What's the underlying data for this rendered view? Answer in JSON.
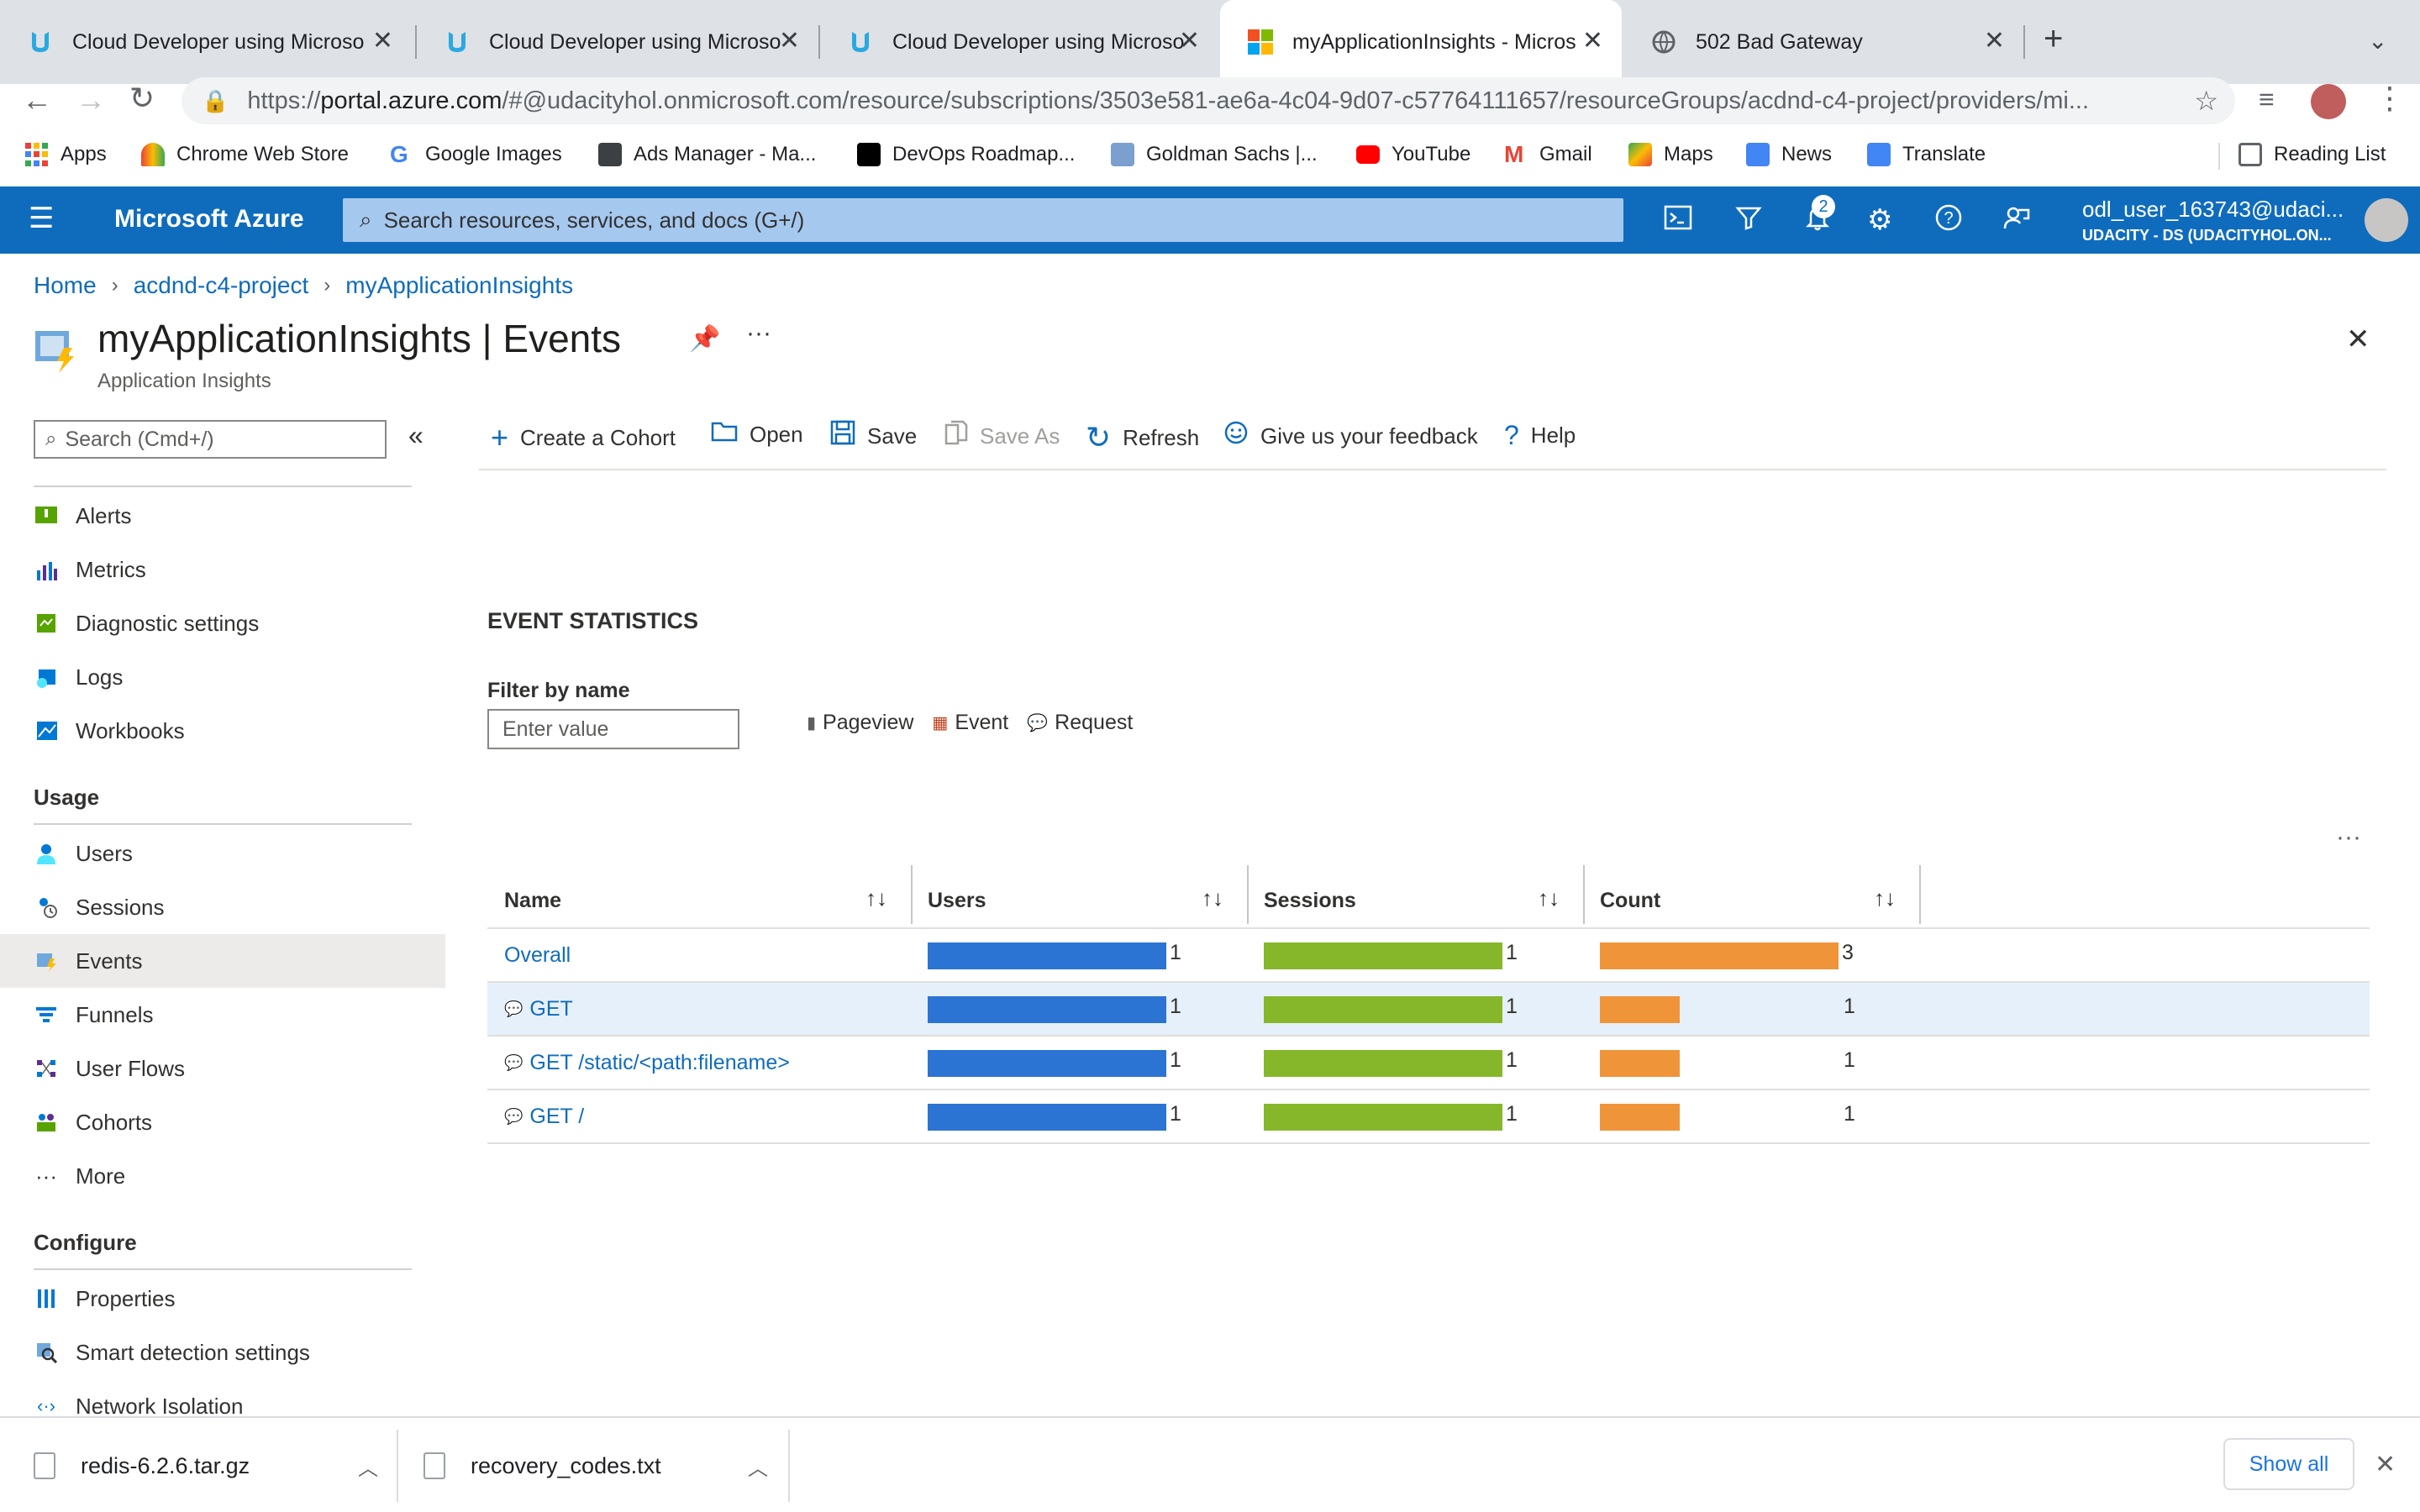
{
  "browser": {
    "tabs": [
      {
        "title": "Cloud Developer using Microso",
        "active": false
      },
      {
        "title": "Cloud Developer using Microso",
        "active": false
      },
      {
        "title": "Cloud Developer using Microso",
        "active": false
      },
      {
        "title": "myApplicationInsights - Micros",
        "active": true
      },
      {
        "title": "502 Bad Gateway",
        "active": false
      }
    ],
    "url_prefix": "https://",
    "url_host": "portal.azure.com",
    "url_path": "/#@udacityhol.onmicrosoft.com/resource/subscriptions/3503e581-ae6a-4c04-9d07-c57764111657/resourceGroups/acdnd-c4-project/providers/mi...",
    "bookmarks": [
      {
        "label": "Apps",
        "color": "#4285f4"
      },
      {
        "label": "Chrome Web Store",
        "color": "#ea4335"
      },
      {
        "label": "Google Images",
        "color": "#34a853"
      },
      {
        "label": "Ads Manager - Ma...",
        "color": "#3c4043"
      },
      {
        "label": "DevOps Roadmap...",
        "color": "#000000"
      },
      {
        "label": "Goldman Sachs |...",
        "color": "#7b9fcf"
      },
      {
        "label": "YouTube",
        "color": "#ff0000"
      },
      {
        "label": "Gmail",
        "color": "#ea4335"
      },
      {
        "label": "Maps",
        "color": "#34a853"
      },
      {
        "label": "News",
        "color": "#4285f4"
      },
      {
        "label": "Translate",
        "color": "#4285f4"
      }
    ],
    "reading_list": "Reading List"
  },
  "azure": {
    "brand": "Microsoft Azure",
    "search_placeholder": "Search resources, services, and docs (G+/)",
    "notification_count": "2",
    "user_name": "odl_user_163743@udaci...",
    "user_tenant": "UDACITY - DS (UDACITYHOL.ON..."
  },
  "breadcrumb": [
    "Home",
    "acdnd-c4-project",
    "myApplicationInsights"
  ],
  "page": {
    "title": "myApplicationInsights | Events",
    "subtitle": "Application Insights"
  },
  "leftnav": {
    "search_placeholder": "Search (Cmd+/)",
    "items_top": [
      {
        "label": "Alerts",
        "icon": "alert-icon"
      },
      {
        "label": "Metrics",
        "icon": "metrics-icon"
      },
      {
        "label": "Diagnostic settings",
        "icon": "diagnostic-icon"
      },
      {
        "label": "Logs",
        "icon": "logs-icon"
      },
      {
        "label": "Workbooks",
        "icon": "workbooks-icon"
      }
    ],
    "usage_header": "Usage",
    "items_usage": [
      {
        "label": "Users",
        "icon": "users-icon"
      },
      {
        "label": "Sessions",
        "icon": "sessions-icon"
      },
      {
        "label": "Events",
        "icon": "events-icon",
        "selected": true
      },
      {
        "label": "Funnels",
        "icon": "funnels-icon"
      },
      {
        "label": "User Flows",
        "icon": "userflows-icon"
      },
      {
        "label": "Cohorts",
        "icon": "cohorts-icon"
      },
      {
        "label": "More",
        "icon": "more-icon"
      }
    ],
    "configure_header": "Configure",
    "items_configure": [
      {
        "label": "Properties",
        "icon": "properties-icon"
      },
      {
        "label": "Smart detection settings",
        "icon": "smart-detection-icon"
      },
      {
        "label": "Network Isolation",
        "icon": "network-icon"
      }
    ]
  },
  "commandbar": {
    "create_cohort": "Create a Cohort",
    "open": "Open",
    "save": "Save",
    "save_as": "Save As",
    "refresh": "Refresh",
    "feedback": "Give us your feedback",
    "help": "Help"
  },
  "stats": {
    "heading": "EVENT STATISTICS",
    "filter_label": "Filter by name",
    "filter_placeholder": "Enter value",
    "legend": [
      "Pageview",
      "Event",
      "Request"
    ]
  },
  "table": {
    "columns": [
      "Name",
      "Users",
      "Sessions",
      "Count"
    ],
    "rows": [
      {
        "name": "Overall",
        "users": "1",
        "sessions": "1",
        "count": "3",
        "count_fraction": 1.0,
        "highlighted": false,
        "icon": false
      },
      {
        "name": "GET",
        "users": "1",
        "sessions": "1",
        "count": "1",
        "count_fraction": 0.333,
        "highlighted": true,
        "icon": true
      },
      {
        "name": "GET /static/<path:filename>",
        "users": "1",
        "sessions": "1",
        "count": "1",
        "count_fraction": 0.333,
        "highlighted": false,
        "icon": true
      },
      {
        "name": "GET /",
        "users": "1",
        "sessions": "1",
        "count": "1",
        "count_fraction": 0.333,
        "highlighted": false,
        "icon": true
      }
    ],
    "colors": {
      "users": "#2c74d4",
      "sessions": "#86b72b",
      "count": "#f0943a"
    }
  },
  "downloads": {
    "files": [
      "redis-6.2.6.tar.gz",
      "recovery_codes.txt"
    ],
    "show_all": "Show all"
  }
}
